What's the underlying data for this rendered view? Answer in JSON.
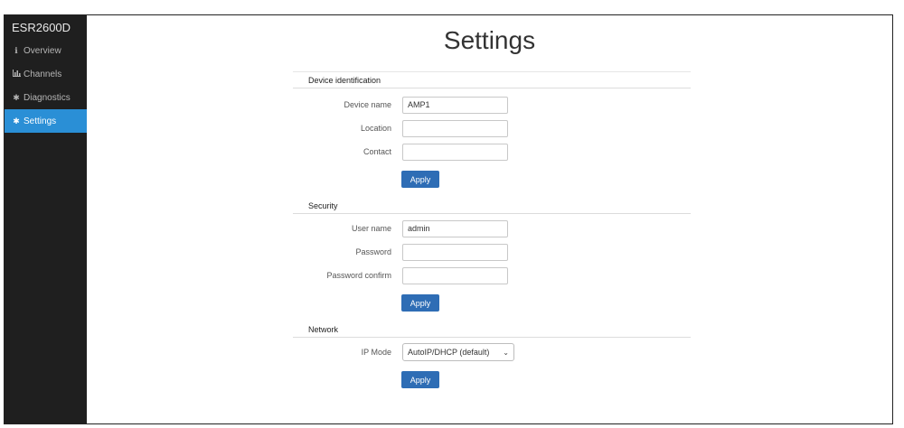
{
  "sidebar": {
    "brand": "ESR2600D",
    "items": [
      {
        "label": "Overview",
        "icon": "info-icon",
        "active": false
      },
      {
        "label": "Channels",
        "icon": "bar-chart-icon",
        "active": false
      },
      {
        "label": "Diagnostics",
        "icon": "gear-icon",
        "active": false
      },
      {
        "label": "Settings",
        "icon": "gear-icon",
        "active": true
      }
    ]
  },
  "page": {
    "title": "Settings"
  },
  "device": {
    "heading": "Device identification",
    "name_label": "Device name",
    "name_value": "AMP1",
    "location_label": "Location",
    "location_value": "",
    "contact_label": "Contact",
    "contact_value": "",
    "apply": "Apply"
  },
  "security": {
    "heading": "Security",
    "user_label": "User name",
    "user_value": "admin",
    "password_label": "Password",
    "password_value": "",
    "confirm_label": "Password confirm",
    "confirm_value": "",
    "apply": "Apply"
  },
  "network": {
    "heading": "Network",
    "ipmode_label": "IP Mode",
    "ipmode_value": "AutoIP/DHCP (default)",
    "apply": "Apply"
  },
  "colors": {
    "sidebar_bg": "#1f1f1f",
    "active_item": "#2a8fd6",
    "button": "#2e6db5"
  }
}
